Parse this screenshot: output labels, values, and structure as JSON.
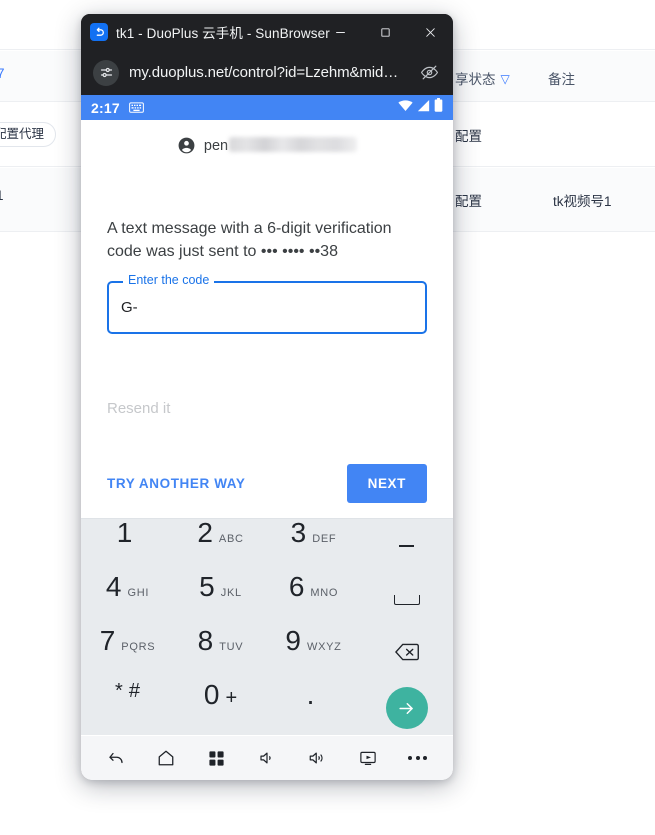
{
  "background": {
    "table": {
      "headers": [
        {
          "label": "享状态",
          "filter_icon": "filter-icon"
        },
        {
          "label": "备注"
        }
      ],
      "left_fragments": [
        "7",
        "配置代理",
        "1"
      ],
      "rows": [
        {
          "status": "配置",
          "note": ""
        },
        {
          "status": "配置",
          "note": "tk视频号1"
        }
      ]
    }
  },
  "window": {
    "app_icon": "duoplus-logo-icon",
    "title": "tk1 - DuoPlus 云手机 - SunBrowser",
    "controls": {
      "minimize": "minimize-icon",
      "maximize": "maximize-icon",
      "close": "close-icon"
    },
    "urlbar": {
      "left_icon": "tune-settings-icon",
      "url": "my.duoplus.net/control?id=Lzehm&mid…",
      "right_icon": "eye-off-icon"
    }
  },
  "phone": {
    "statusbar": {
      "time": "2:17",
      "keyboard_icon": "keyboard-icon",
      "wifi_icon": "wifi-icon",
      "signal_icon": "signal-icon",
      "battery_icon": "battery-icon"
    },
    "account": {
      "avatar_icon": "account-circle-icon",
      "name": "pen"
    },
    "message": "A text message with a 6-digit verification code was just sent to ••• •••• ••38",
    "code_field": {
      "label": "Enter the code",
      "value": "G-",
      "placeholder": "Enter the code"
    },
    "resend": "Resend it",
    "try_another_way": "TRY ANOTHER WAY",
    "next": "NEXT",
    "keyboard": {
      "keys": [
        {
          "num": "1",
          "sub": ""
        },
        {
          "num": "2",
          "sub": "ABC"
        },
        {
          "num": "3",
          "sub": "DEF"
        },
        {
          "num": "",
          "sub": "",
          "icon": "dash-key-icon"
        },
        {
          "num": "4",
          "sub": "GHI"
        },
        {
          "num": "5",
          "sub": "JKL"
        },
        {
          "num": "6",
          "sub": "MNO"
        },
        {
          "num": "",
          "sub": "",
          "icon": "space-key-icon"
        },
        {
          "num": "7",
          "sub": "PQRS"
        },
        {
          "num": "8",
          "sub": "TUV"
        },
        {
          "num": "9",
          "sub": "WXYZ"
        },
        {
          "num": "",
          "sub": "",
          "icon": "backspace-key-icon"
        },
        {
          "num": "*",
          "sub": "#",
          "symbol": true
        },
        {
          "num": "0",
          "sub": "+"
        },
        {
          "num": ".",
          "sub": "",
          "symbol": true
        },
        {
          "num": "",
          "sub": "",
          "icon": "send-arrow-icon"
        }
      ]
    },
    "navbar": [
      "back-icon",
      "home-icon",
      "recent-apps-icon",
      "volume-down-icon",
      "volume-up-icon",
      "screencast-icon",
      "more-icon"
    ]
  },
  "colors": {
    "android_blue": "#4285f4",
    "field_blue": "#1a73e8",
    "send_green": "#3eb3a0",
    "titlebar_dark": "#202124",
    "keyboard_bg": "#e8ebee"
  }
}
